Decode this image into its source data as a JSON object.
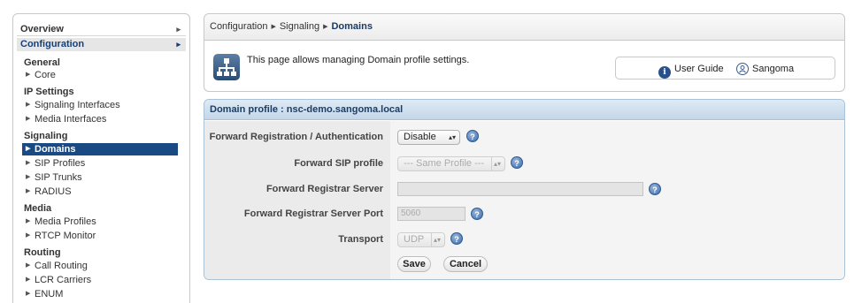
{
  "sidebar": {
    "overview": "Overview",
    "configuration": "Configuration",
    "sections": [
      {
        "title": "General",
        "items": [
          "Core"
        ]
      },
      {
        "title": "IP Settings",
        "items": [
          "Signaling Interfaces",
          "Media Interfaces"
        ]
      },
      {
        "title": "Signaling",
        "items": [
          "Domains",
          "SIP Profiles",
          "SIP Trunks",
          "RADIUS"
        ]
      },
      {
        "title": "Media",
        "items": [
          "Media Profiles",
          "RTCP Monitor"
        ]
      },
      {
        "title": "Routing",
        "items": [
          "Call Routing",
          "LCR Carriers",
          "ENUM"
        ]
      }
    ]
  },
  "breadcrumb": {
    "items": [
      "Configuration",
      "Signaling",
      "Domains"
    ]
  },
  "info": {
    "text": "This page allows managing Domain profile settings.",
    "user_guide": "User Guide",
    "sangoma": "Sangoma"
  },
  "panel": {
    "title": "Domain profile : nsc-demo.sangoma.local",
    "fields": {
      "forward_reg_auth": {
        "label": "Forward Registration / Authentication",
        "value": "Disable"
      },
      "forward_sip_profile": {
        "label": "Forward SIP profile",
        "value": "--- Same Profile ---"
      },
      "forward_registrar_server": {
        "label": "Forward Registrar Server",
        "value": ""
      },
      "forward_registrar_port": {
        "label": "Forward Registrar Server Port",
        "placeholder": "5060"
      },
      "transport": {
        "label": "Transport",
        "value": "UDP"
      }
    },
    "save_label": "Save",
    "cancel_label": "Cancel"
  },
  "icons": {
    "help": "help-icon",
    "info": "info-icon",
    "user": "user-icon",
    "app": "domains-app-icon"
  },
  "colors": {
    "nav_active_bg": "#1a4a83",
    "panel_header_bg": "#c3d6e8",
    "title_text": "#1d3d62"
  }
}
